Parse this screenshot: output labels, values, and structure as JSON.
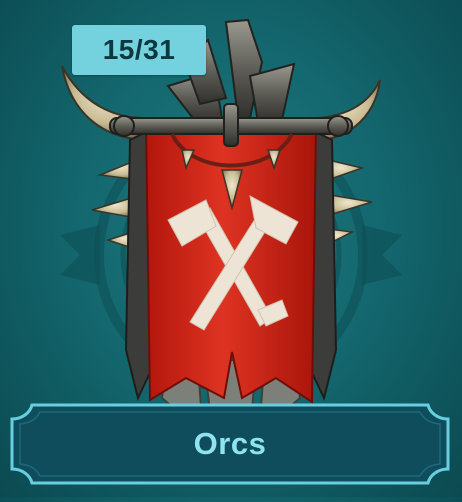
{
  "faction": {
    "name": "Orcs",
    "collection_count": "15/31",
    "emblem_icon": "orc-war-banner-crossed-axes-icon"
  },
  "colors": {
    "background": "#14686f",
    "badge_fill": "#74d1de",
    "badge_text": "#0c3840",
    "banner_fill": "#0f4d5c",
    "banner_border": "#67cfe0",
    "name_text": "#8fe3ef",
    "flag_red": "#d32a1c"
  }
}
